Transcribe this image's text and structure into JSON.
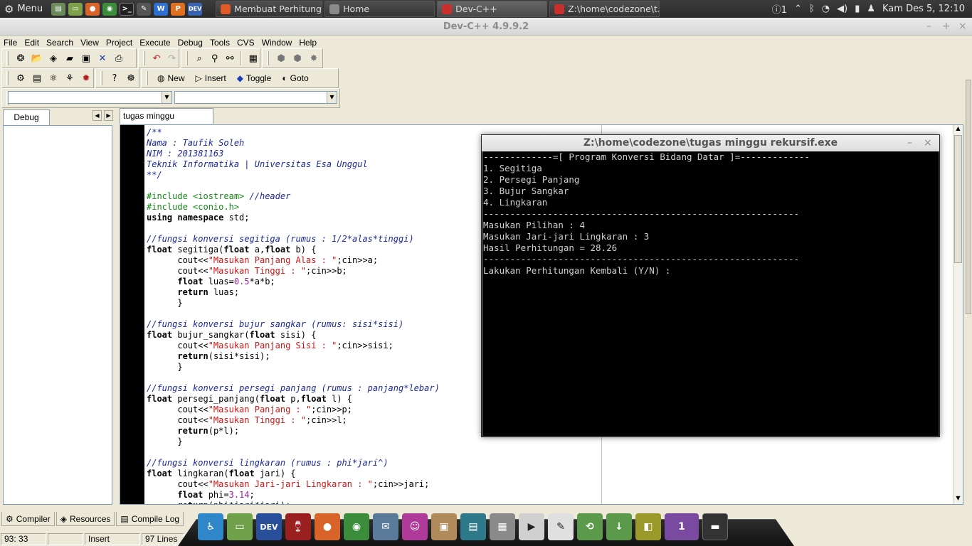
{
  "topbar": {
    "menu_label": "Menu",
    "launchers": [
      "file-manager-icon",
      "folder-icon",
      "firefox-icon",
      "chrome-icon",
      "terminal-icon",
      "text-editor-icon",
      "wps-writer-icon",
      "wps-presentation-icon",
      "devcpp-icon"
    ],
    "tasks": [
      {
        "label": "Membuat Perhitung...",
        "color": "#e05a2a",
        "icon": "chrome-icon"
      },
      {
        "label": "Home",
        "color": "#8a8a8a",
        "icon": "folder-icon"
      },
      {
        "label": "Dev-C++",
        "color": "#c9302c",
        "icon": "devcpp-icon"
      },
      {
        "label": "Z:\\home\\codezone\\t...",
        "color": "#c9302c",
        "icon": "wine-console-icon"
      }
    ],
    "tray": {
      "notifications": "1",
      "clock": "Kam Des  5, 12:10"
    }
  },
  "window": {
    "title": "Dev-C++ 4.9.9.2"
  },
  "menubar": [
    "File",
    "Edit",
    "Search",
    "View",
    "Project",
    "Execute",
    "Debug",
    "Tools",
    "CVS",
    "Window",
    "Help"
  ],
  "toolbar2": {
    "new": "New",
    "insert": "Insert",
    "toggle": "Toggle",
    "goto": "Goto"
  },
  "left_panel": {
    "tab": "Debug"
  },
  "editor": {
    "tab": "tugas minggu rekursif.cpp"
  },
  "console": {
    "title": "Z:\\home\\codezone\\tugas minggu rekursif.exe",
    "lines": [
      "-------------=[ Program Konversi Bidang Datar ]=-------------",
      "1. Segitiga",
      "2. Persegi Panjang",
      "3. Bujur Sangkar",
      "4. Lingkaran",
      "-----------------------------------------------------------",
      "Masukan Pilihan : 4",
      "Masukan Jari-jari Lingkaran : 3",
      "Hasil Perhitungan = 28.26",
      "-----------------------------------------------------------",
      "Lakukan Perhitungan Kembali (Y/N) :"
    ]
  },
  "bottom_tabs": [
    "Compiler",
    "Resources",
    "Compile Log"
  ],
  "statusbar": {
    "position": "93: 33",
    "mode": "Insert",
    "lines": "97 Lines"
  },
  "dock": {
    "workspace": "1"
  }
}
